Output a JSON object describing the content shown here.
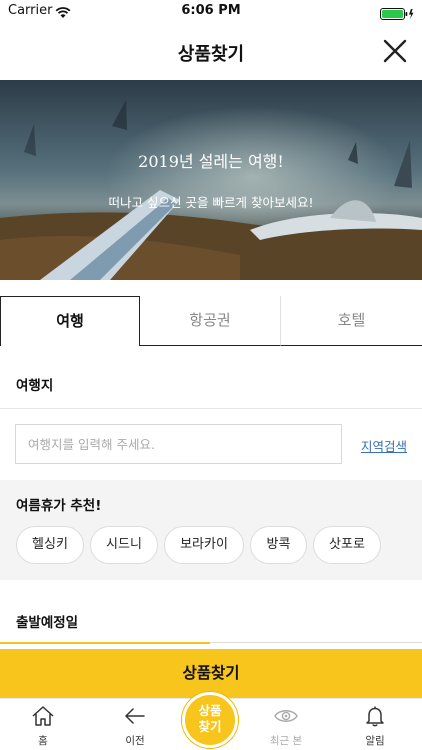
{
  "status": {
    "carrier": "Carrier",
    "time": "6:06 PM"
  },
  "header": {
    "title": "상품찾기"
  },
  "hero": {
    "title": "2019년 설레는 여행!",
    "subtitle": "떠나고 싶으신 곳을 빠르게 찾아보세요!"
  },
  "tabs": [
    {
      "label": "여행",
      "active": true
    },
    {
      "label": "항공권",
      "active": false
    },
    {
      "label": "호텔",
      "active": false
    }
  ],
  "destination": {
    "label": "여행지",
    "placeholder": "여행지를 입력해 주세요.",
    "value": "",
    "region_search": "지역검색"
  },
  "summer": {
    "label": "여름휴가 추천!",
    "chips": [
      "헬싱키",
      "시드니",
      "보라카이",
      "방콕",
      "삿포로"
    ]
  },
  "departure": {
    "label": "출발예정일"
  },
  "search_button": {
    "label": "상품찾기"
  },
  "tabbar": {
    "items": [
      {
        "label": "홈",
        "icon": "home-icon"
      },
      {
        "label": "이전",
        "icon": "back-arrow-icon"
      },
      {
        "label": "최근 본",
        "icon": "eye-icon"
      },
      {
        "label": "알림",
        "icon": "bell-icon"
      }
    ],
    "center_line1": "상품",
    "center_line2": "찾기"
  },
  "colors": {
    "accent": "#F8C51D",
    "link": "#3A6FB0"
  }
}
